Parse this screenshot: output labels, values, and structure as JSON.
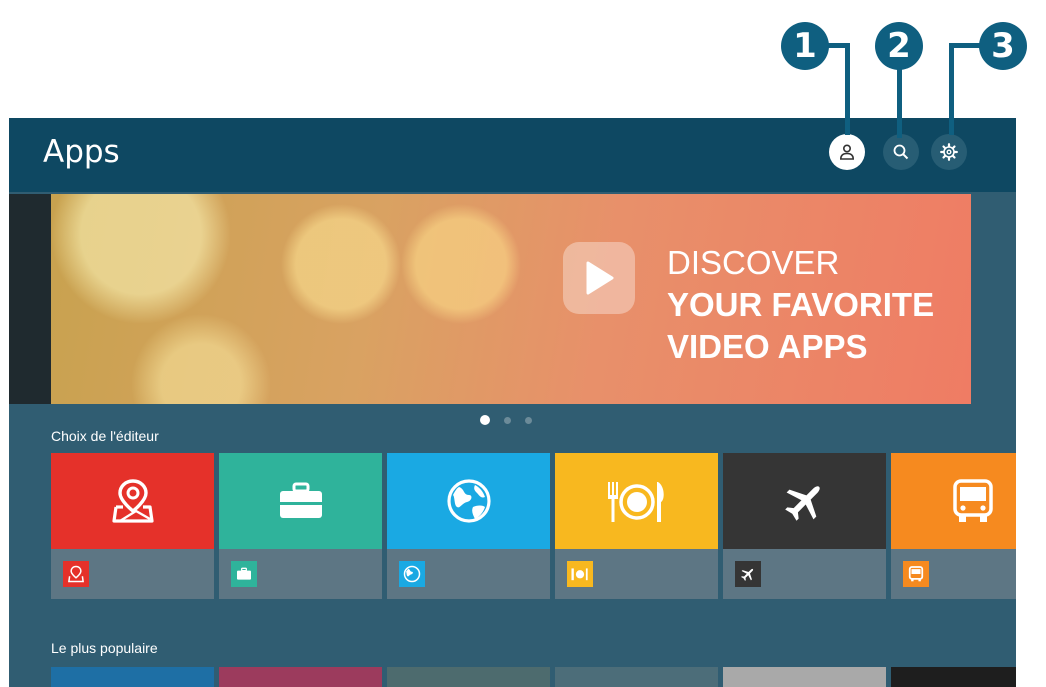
{
  "callouts": [
    {
      "label": "1",
      "target": "account-button"
    },
    {
      "label": "2",
      "target": "search-button"
    },
    {
      "label": "3",
      "target": "settings-button"
    }
  ],
  "header": {
    "title": "Apps",
    "buttons": [
      {
        "icon": "person-icon",
        "state": "focused"
      },
      {
        "icon": "search-icon",
        "state": "normal"
      },
      {
        "icon": "gear-icon",
        "state": "normal"
      }
    ]
  },
  "banner": {
    "line1": "DISCOVER",
    "line2": "YOUR FAVORITE",
    "line3": "VIDEO APPS",
    "icon": "play-icon",
    "page_indicator": {
      "pages": 3,
      "current": 1
    }
  },
  "sections": {
    "editors_choice": {
      "title": "Choix de l'éditeur",
      "tiles": [
        {
          "icon": "map-pin-icon",
          "color": "#e5312a"
        },
        {
          "icon": "briefcase-icon",
          "color": "#2fb39b"
        },
        {
          "icon": "globe-icon",
          "color": "#1aa9e3"
        },
        {
          "icon": "dining-icon",
          "color": "#f8b81f"
        },
        {
          "icon": "airplane-icon",
          "color": "#353535"
        },
        {
          "icon": "bus-icon",
          "color": "#f68a1f"
        }
      ]
    },
    "most_popular": {
      "title": "Le plus populaire",
      "tile_colors": [
        "#1e6fa5",
        "#9c3b5d",
        "#4d6b6e",
        "#4c6d79",
        "#a9a9a9",
        "#1e1e1e"
      ]
    }
  },
  "colors": {
    "callout": "#0f5f80",
    "header_bg": "#0e4862",
    "page_bg": "#305d72"
  }
}
